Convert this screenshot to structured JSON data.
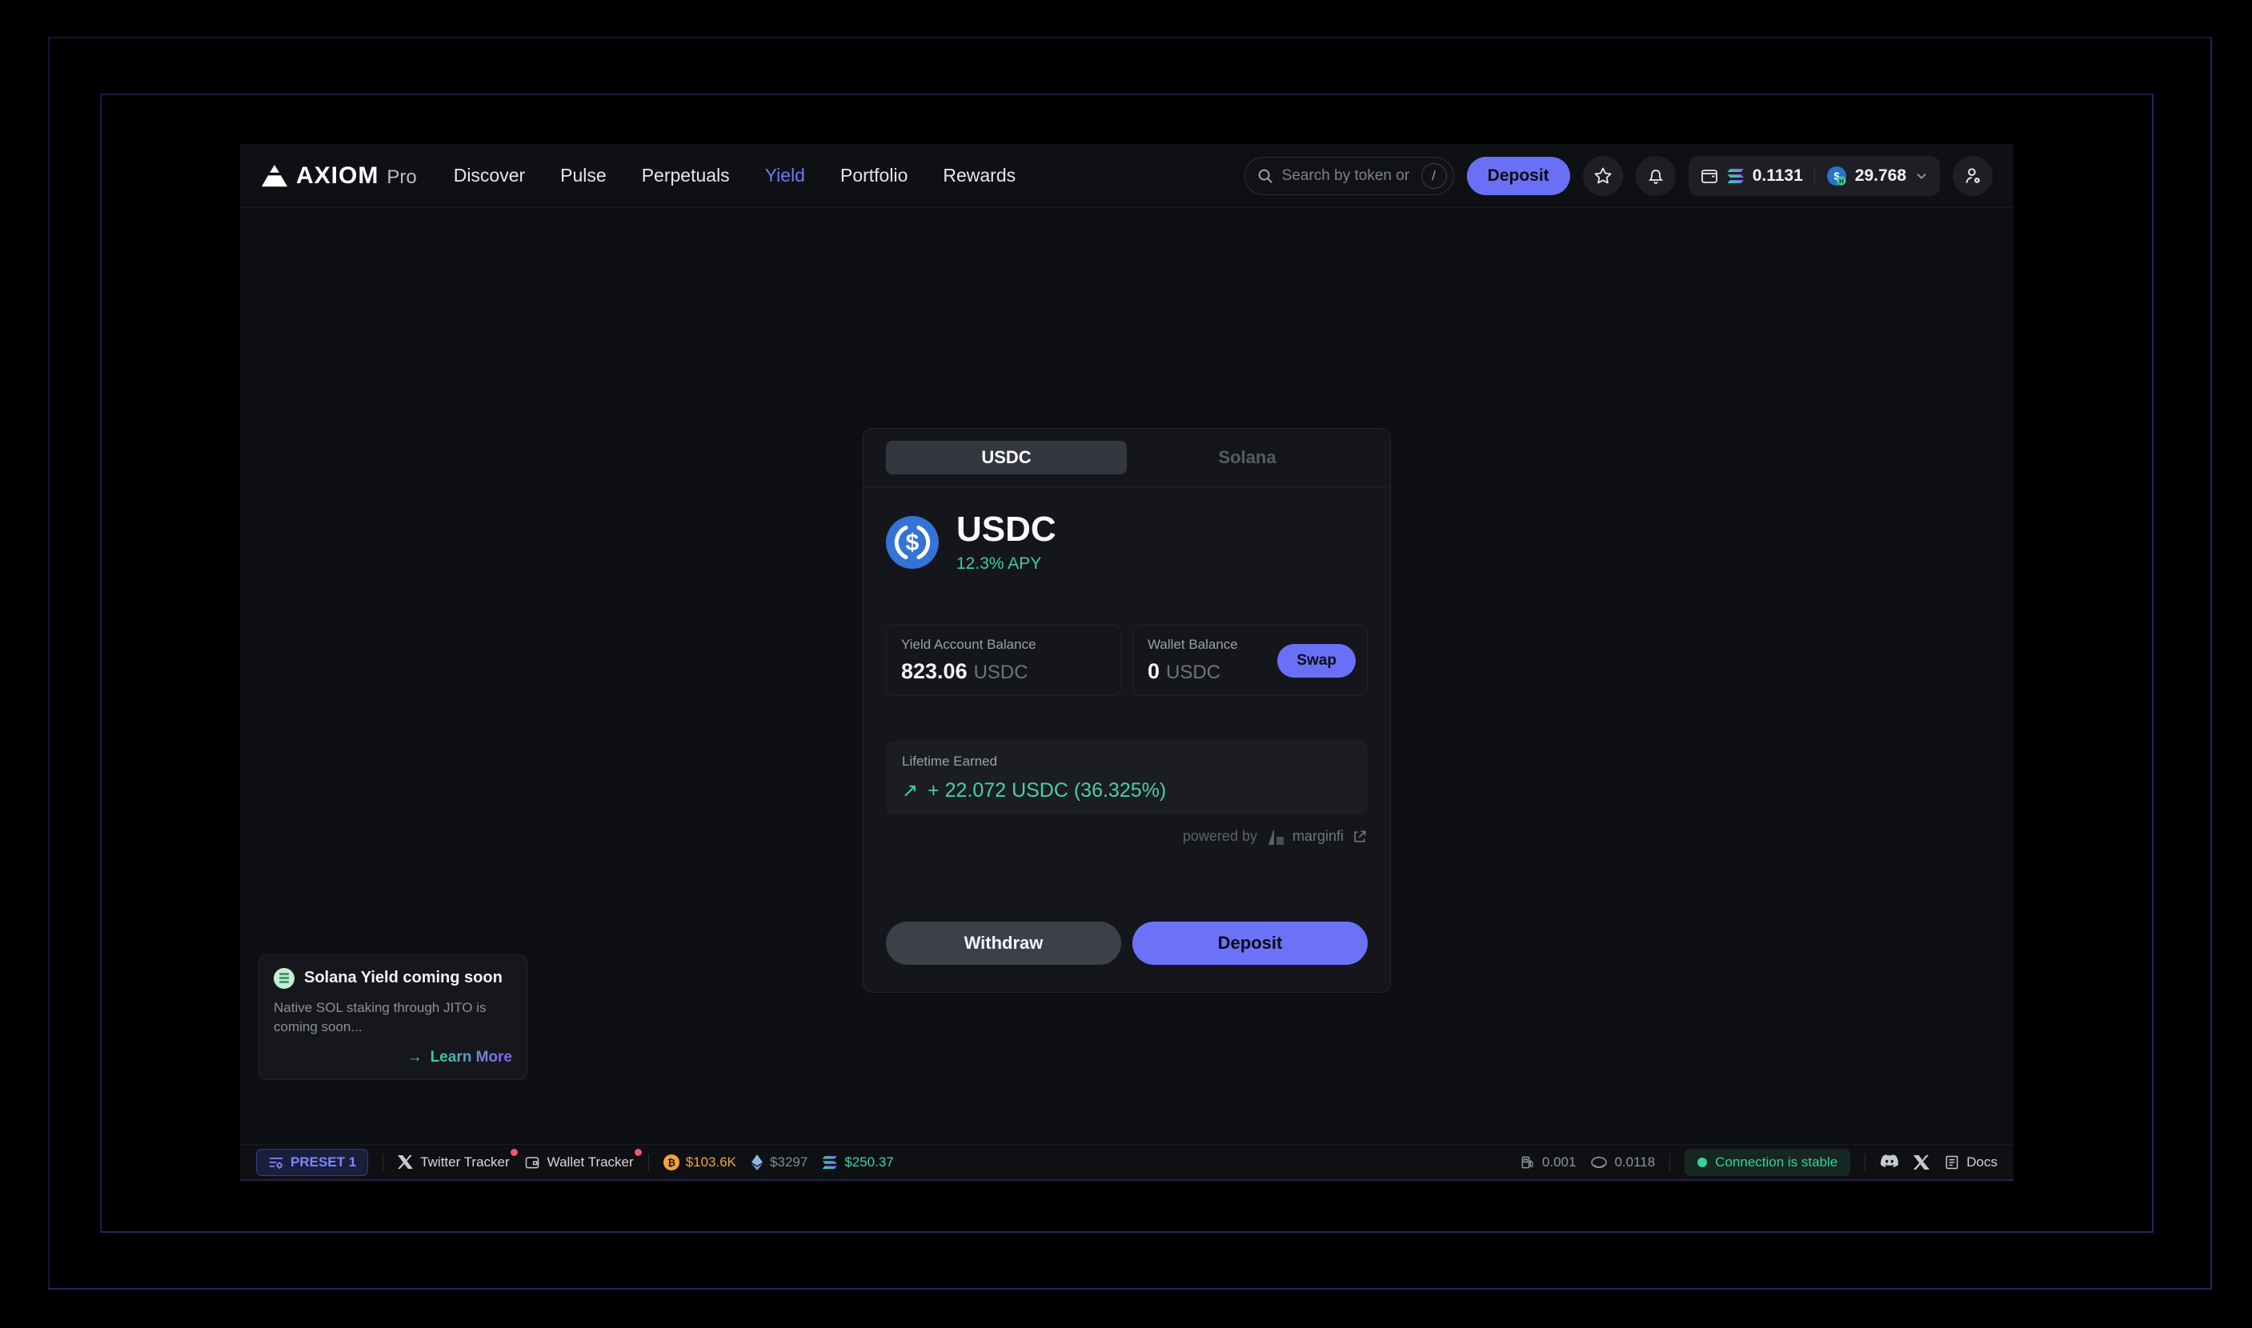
{
  "nav": {
    "brand": "AXIOM",
    "brand_suffix": "Pro",
    "items": [
      "Discover",
      "Pulse",
      "Perpetuals",
      "Yield",
      "Portfolio",
      "Rewards"
    ]
  },
  "topbar": {
    "search_placeholder": "Search by token or CA...",
    "search_shortcut": "/",
    "deposit_label": "Deposit",
    "sol_balance": "0.1131",
    "usdc_balance": "29.768"
  },
  "card": {
    "tabs": {
      "usdc": "USDC",
      "solana": "Solana"
    },
    "token_name": "USDC",
    "apy": "12.3% APY",
    "yield_balance_label": "Yield Account Balance",
    "yield_balance_value": "823.06",
    "yield_balance_unit": "USDC",
    "wallet_balance_label": "Wallet Balance",
    "wallet_balance_value": "0",
    "wallet_balance_unit": "USDC",
    "swap_label": "Swap",
    "lifetime_label": "Lifetime Earned",
    "lifetime_arrow": "↗",
    "lifetime_value": "+ 22.072 USDC (36.325%)",
    "powered_by": "powered by",
    "provider": "marginfi",
    "withdraw_label": "Withdraw",
    "deposit_label": "Deposit"
  },
  "toast": {
    "title": "Solana Yield coming soon",
    "body": "Native SOL staking through JITO is coming soon...",
    "cta_arrow": "→",
    "cta": "Learn More"
  },
  "statusbar": {
    "preset": "PRESET 1",
    "twitter_tracker": "Twitter Tracker",
    "wallet_tracker": "Wallet Tracker",
    "btc_price": "$103.6K",
    "eth_price": "$3297",
    "sol_price": "$250.37",
    "gas": "0.001",
    "priority_fee": "0.0118",
    "connection": "Connection is stable",
    "docs": "Docs"
  },
  "colors": {
    "accent_indigo": "#6a70f6",
    "green": "#3ecf96",
    "usdc_blue": "#2775ca",
    "btc_orange": "#f0a33c",
    "alert_red": "#f4536e"
  }
}
